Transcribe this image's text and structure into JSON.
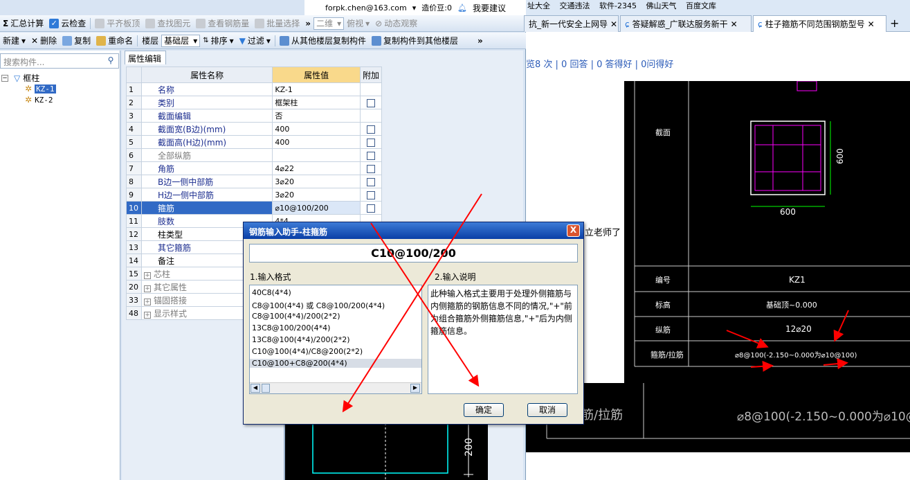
{
  "app": {
    "topbar": {
      "sum_label": "汇总计算",
      "cloud_check": "云检查",
      "flat_slab": "平齐板顶",
      "find_elem": "查找图元",
      "view_rebar": "查看钢筋量",
      "batch_select": "批量选择",
      "email": "forpk.chen@163.com",
      "credits": "造价豆:0",
      "suggest": "我要建议",
      "view2d": "二维",
      "top_view": "俯视",
      "dynamic": "动态观察"
    },
    "toolbar2": {
      "new": "新建",
      "delete": "删除",
      "copy": "复制",
      "rename": "重命名",
      "floor_label": "楼层",
      "floor_value": "基础层",
      "sort": "排序",
      "filter": "过滤",
      "copy_from": "从其他楼层复制构件",
      "copy_to": "复制构件到其他楼层"
    },
    "tree": {
      "search_placeholder": "搜索构件...",
      "root": "框柱",
      "items": [
        "KZ-1",
        "KZ-2"
      ]
    },
    "prop_tab": "属性编辑",
    "grid": {
      "headers": [
        "属性名称",
        "属性值",
        "附加"
      ],
      "rows": [
        {
          "n": "1",
          "name": "名称",
          "value": "KZ-1",
          "cb": false
        },
        {
          "n": "2",
          "name": "类别",
          "value": "框架柱",
          "cb": true
        },
        {
          "n": "3",
          "name": "截面编辑",
          "value": "否",
          "cb": false
        },
        {
          "n": "4",
          "name": "截面宽(B边)(mm)",
          "value": "400",
          "cb": true
        },
        {
          "n": "5",
          "name": "截面高(H边)(mm)",
          "value": "400",
          "cb": true
        },
        {
          "n": "6",
          "name": "全部纵筋",
          "value": "",
          "cb": true
        },
        {
          "n": "7",
          "name": "角筋",
          "value": "4⌀22",
          "cb": true
        },
        {
          "n": "8",
          "name": "B边一侧中部筋",
          "value": "3⌀20",
          "cb": true
        },
        {
          "n": "9",
          "name": "H边一侧中部筋",
          "value": "3⌀20",
          "cb": true
        },
        {
          "n": "10",
          "name": "箍筋",
          "value": "⌀10@100/200",
          "cb": true
        },
        {
          "n": "11",
          "name": "肢数",
          "value": "4*4",
          "cb": false
        },
        {
          "n": "12",
          "name": "柱类型",
          "value": "",
          "cb": false
        },
        {
          "n": "13",
          "name": "其它箍筋",
          "value": "",
          "cb": false
        },
        {
          "n": "14",
          "name": "备注",
          "value": "",
          "cb": false
        },
        {
          "n": "15",
          "name": "芯柱",
          "value": "",
          "cb": false
        },
        {
          "n": "20",
          "name": "其它属性",
          "value": "",
          "cb": false
        },
        {
          "n": "33",
          "name": "锚固搭接",
          "value": "",
          "cb": false
        },
        {
          "n": "48",
          "name": "显示样式",
          "value": "",
          "cb": false
        }
      ]
    },
    "cad_dim": "200"
  },
  "browser": {
    "bookmarks": [
      "址大全",
      "交通违法",
      "软件-2345",
      "佛山天气",
      "百度文库"
    ],
    "tabs": [
      "抗_新一代安全上网导",
      "答疑解惑_广联达服务新干",
      "柱子箍筋不同范围钢筋型号"
    ],
    "stats": "览8 次 | 0 回答 | 0 答得好 | 0问得好",
    "partial_text": "立老师了",
    "cad": {
      "label_section": "截面",
      "dim_600_h": "600",
      "dim_600_v": "600",
      "label_code": "编号",
      "code_value": "KZ1",
      "label_elev": "标高",
      "elev_value": "基础顶~0.000",
      "label_long": "纵筋",
      "long_value": "12⌀20",
      "label_stirrup": "箍筋/拉筋",
      "stirrup_value": "⌀8@100(-2.150~0.000为⌀10@100)",
      "big_label": "筋/拉筋",
      "big_value": "⌀8@100(-2.150~0.000为⌀10@"
    }
  },
  "dialog": {
    "title": "钢筋输入助手-柱箍筋",
    "input_value": "C10@100/200",
    "sec1": "1.输入格式",
    "sec2": "2.输入说明",
    "formats": [
      "40C8(4*4)",
      "C8@100(4*4) 或 C8@100/200(4*4)",
      "C8@100(4*4)/200(2*2)",
      "13C8@100/200(4*4)",
      "13C8@100(4*4)/200(2*2)",
      "C10@100(4*4)/C8@200(2*2)",
      "C10@100+C8@200(4*4)"
    ],
    "description": "此种输入格式主要用于处理外侧箍筋与内侧箍筋的钢筋信息不同的情况,\"+\"前为组合箍筋外侧箍筋信息,\"+\"后为内侧箍筋信息。",
    "ok": "确定",
    "cancel": "取消",
    "close": "X"
  },
  "colors": {
    "accent": "#316ac5",
    "header_value": "#f9d98b",
    "annotation": "#ff0000",
    "cad_cyan": "#00ffff",
    "cad_magenta": "#ff00ff",
    "cad_green": "#00ff00"
  }
}
